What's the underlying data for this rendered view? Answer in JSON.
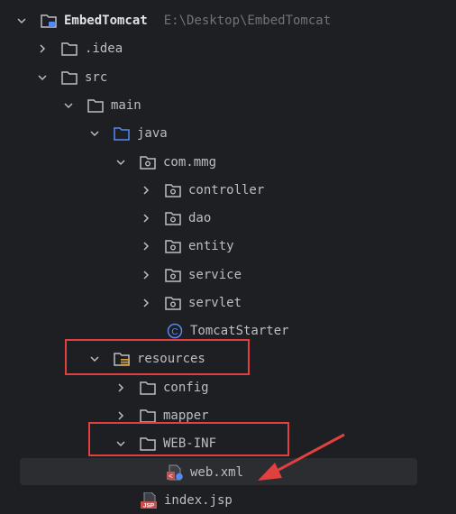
{
  "project": {
    "name": "EmbedTomcat",
    "path": "E:\\Desktop\\EmbedTomcat"
  },
  "tree": {
    "idea": ".idea",
    "src": "src",
    "main": "main",
    "java": "java",
    "com_mmg": "com.mmg",
    "controller": "controller",
    "dao": "dao",
    "entity": "entity",
    "service": "service",
    "servlet": "servlet",
    "tomcat_starter": "TomcatStarter",
    "resources": "resources",
    "config": "config",
    "mapper": "mapper",
    "web_inf": "WEB-INF",
    "web_xml": "web.xml",
    "index_jsp": "index.jsp"
  },
  "colors": {
    "background": "#1e1f22",
    "selection": "#2b2d30",
    "highlight_red": "#e0403f",
    "text": "#bcbec4",
    "folder_icon": "#bcbec4",
    "source_folder_icon": "#548af7",
    "class_icon": "#548af7",
    "jsp_icon": "#c94f4f"
  }
}
